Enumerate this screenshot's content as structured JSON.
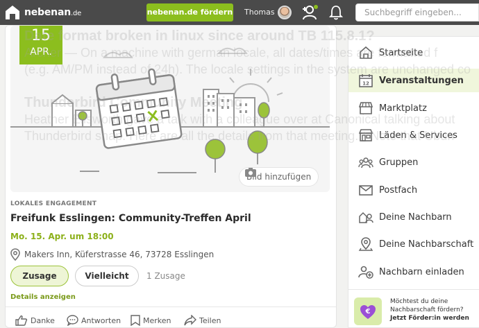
{
  "topbar": {
    "logo_text": "nebenan",
    "logo_tld": ".de",
    "promo_button": "nebenan.de fördern",
    "user_name": "Thomas",
    "search_placeholder": "Suchbegriff eingeben...",
    "colors": {
      "bar": "#4a4a4a",
      "accent": "#8cbe1e"
    }
  },
  "event": {
    "date_day": "15",
    "date_month": "APR.",
    "add_photo_label": "Bild hinzufügen",
    "category": "LOKALES ENGAGEMENT",
    "title": "Freifunk Esslingen: Community-Treffen April",
    "time": "Mo. 15. Apr. um 18:00",
    "location": "Makers Inn, Küferstrasse 46, 73728 Esslingen",
    "btn_yes": "Zusage",
    "btn_maybe": "Vielleicht",
    "count": "1 Zusage",
    "details_link": "Details anzeigen",
    "actions": {
      "like": "Danke",
      "reply": "Antworten",
      "bookmark": "Merken",
      "share": "Teilen"
    }
  },
  "sidebar": {
    "items": [
      {
        "label": "Startseite",
        "icon": "home-icon"
      },
      {
        "label": "Veranstaltungen",
        "icon": "calendar-icon",
        "active": true
      },
      {
        "label": "Marktplatz",
        "icon": "market-stall-icon"
      },
      {
        "label": "Läden & Services",
        "icon": "shop-icon"
      },
      {
        "label": "Gruppen",
        "icon": "group-icon"
      },
      {
        "label": "Postfach",
        "icon": "mail-icon"
      },
      {
        "label": "Deine Nachbarn",
        "icon": "neighbors-icon"
      },
      {
        "label": "Deine Nachbarschaft",
        "icon": "map-pin-icon"
      },
      {
        "label": "Nachbarn einladen",
        "icon": "invite-icon"
      }
    ],
    "promo_question": "Möchtest du deine Nachbarschaft fördern?",
    "promo_link": "Jetzt Förder:in werden"
  },
  "overlay": {
    "line1": "Date format broken in linux since around TB 115.8.1?",
    "line2": "Archer — On a machine with german locale, all dates/times are formatted f",
    "line3": "(e.g. AM/PM instead of 24h). The locale settings in the system are unchanged co",
    "line4": "Thunderbird Community Meeting",
    "line5": "Heather Ellsworth gave a talk with a colleague over at Canonical talking about",
    "line6": "Thunderbird snap. Here are all the details from that meeting. * Note that Ubun"
  }
}
